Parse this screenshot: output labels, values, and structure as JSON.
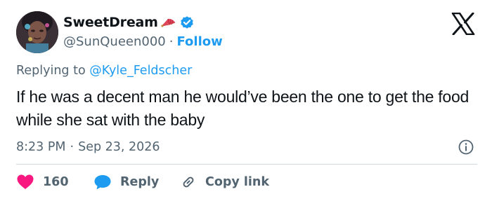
{
  "author": {
    "display_name": "SweetDream",
    "handle": "@SunQueen000",
    "separator": "·",
    "follow_label": "Follow"
  },
  "reply_to": {
    "prefix": "Replying to",
    "mention": "@Kyle_Feldscher"
  },
  "tweet": {
    "text": "If he was a decent man he would’ve been the one to get the food while she sat with the baby"
  },
  "meta": {
    "time": "8:23 PM",
    "separator": "·",
    "date": "Sep 23, 2026"
  },
  "actions": {
    "like_count": "160",
    "reply_label": "Reply",
    "copy_label": "Copy link"
  },
  "icons": {
    "fan": "fan-emoji-icon",
    "verified": "verified-badge-icon",
    "logo": "x-logo-icon",
    "info": "info-icon",
    "like": "heart-icon",
    "reply": "speech-bubble-icon",
    "copy": "link-icon"
  },
  "colors": {
    "accent": "#1d9bf0",
    "like": "#f91880",
    "muted_text": "#536471",
    "text": "#0f1419",
    "divider": "#cfd9de"
  }
}
